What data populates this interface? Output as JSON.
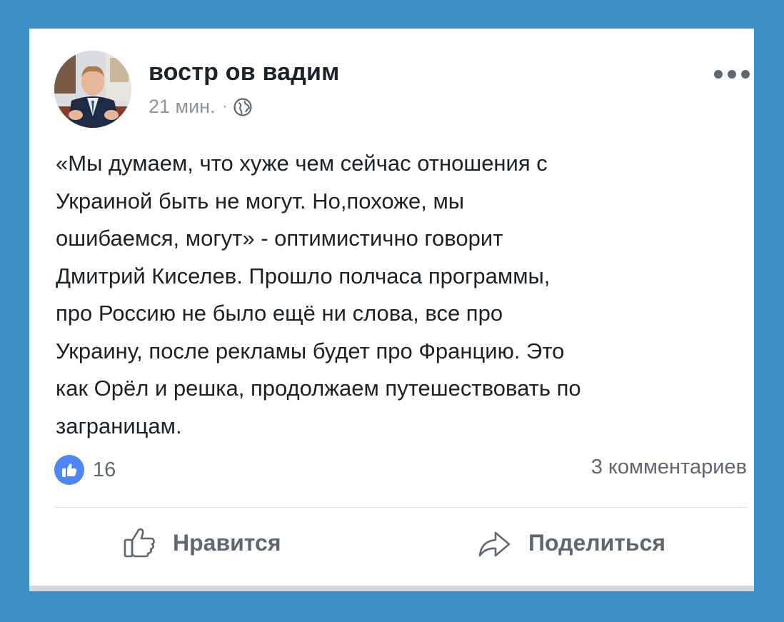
{
  "post": {
    "author": "востр ов вадим",
    "time": "21 мин.",
    "separator": "·",
    "privacy_icon": "globe-icon",
    "text": "«Мы думаем, что хуже чем сейчас отношения с\nУкраиной быть не могут. Но,похоже, мы\nошибаемся, могут» - оптимистично говорит\nДмитрий Киселев. Прошло полчаса программы,\nпро Россию не было ещё ни слова, все про\nУкраину, после рекламы будет про Францию. Это\nкак Орёл и решка, продолжаем путешествовать по\nзаграницам."
  },
  "stats": {
    "likes_icon": "like-reaction-icon",
    "likes_count": "16",
    "comments": "3 комментариев"
  },
  "actions": {
    "like_label": "Нравится",
    "like_icon": "thumbs-up-icon",
    "share_label": "Поделиться",
    "share_icon": "share-arrow-icon"
  },
  "colors": {
    "background": "#3b8fc4",
    "card": "#ffffff",
    "text": "#1d2129",
    "secondary": "#606770",
    "like_blue": "#4f86f7"
  }
}
